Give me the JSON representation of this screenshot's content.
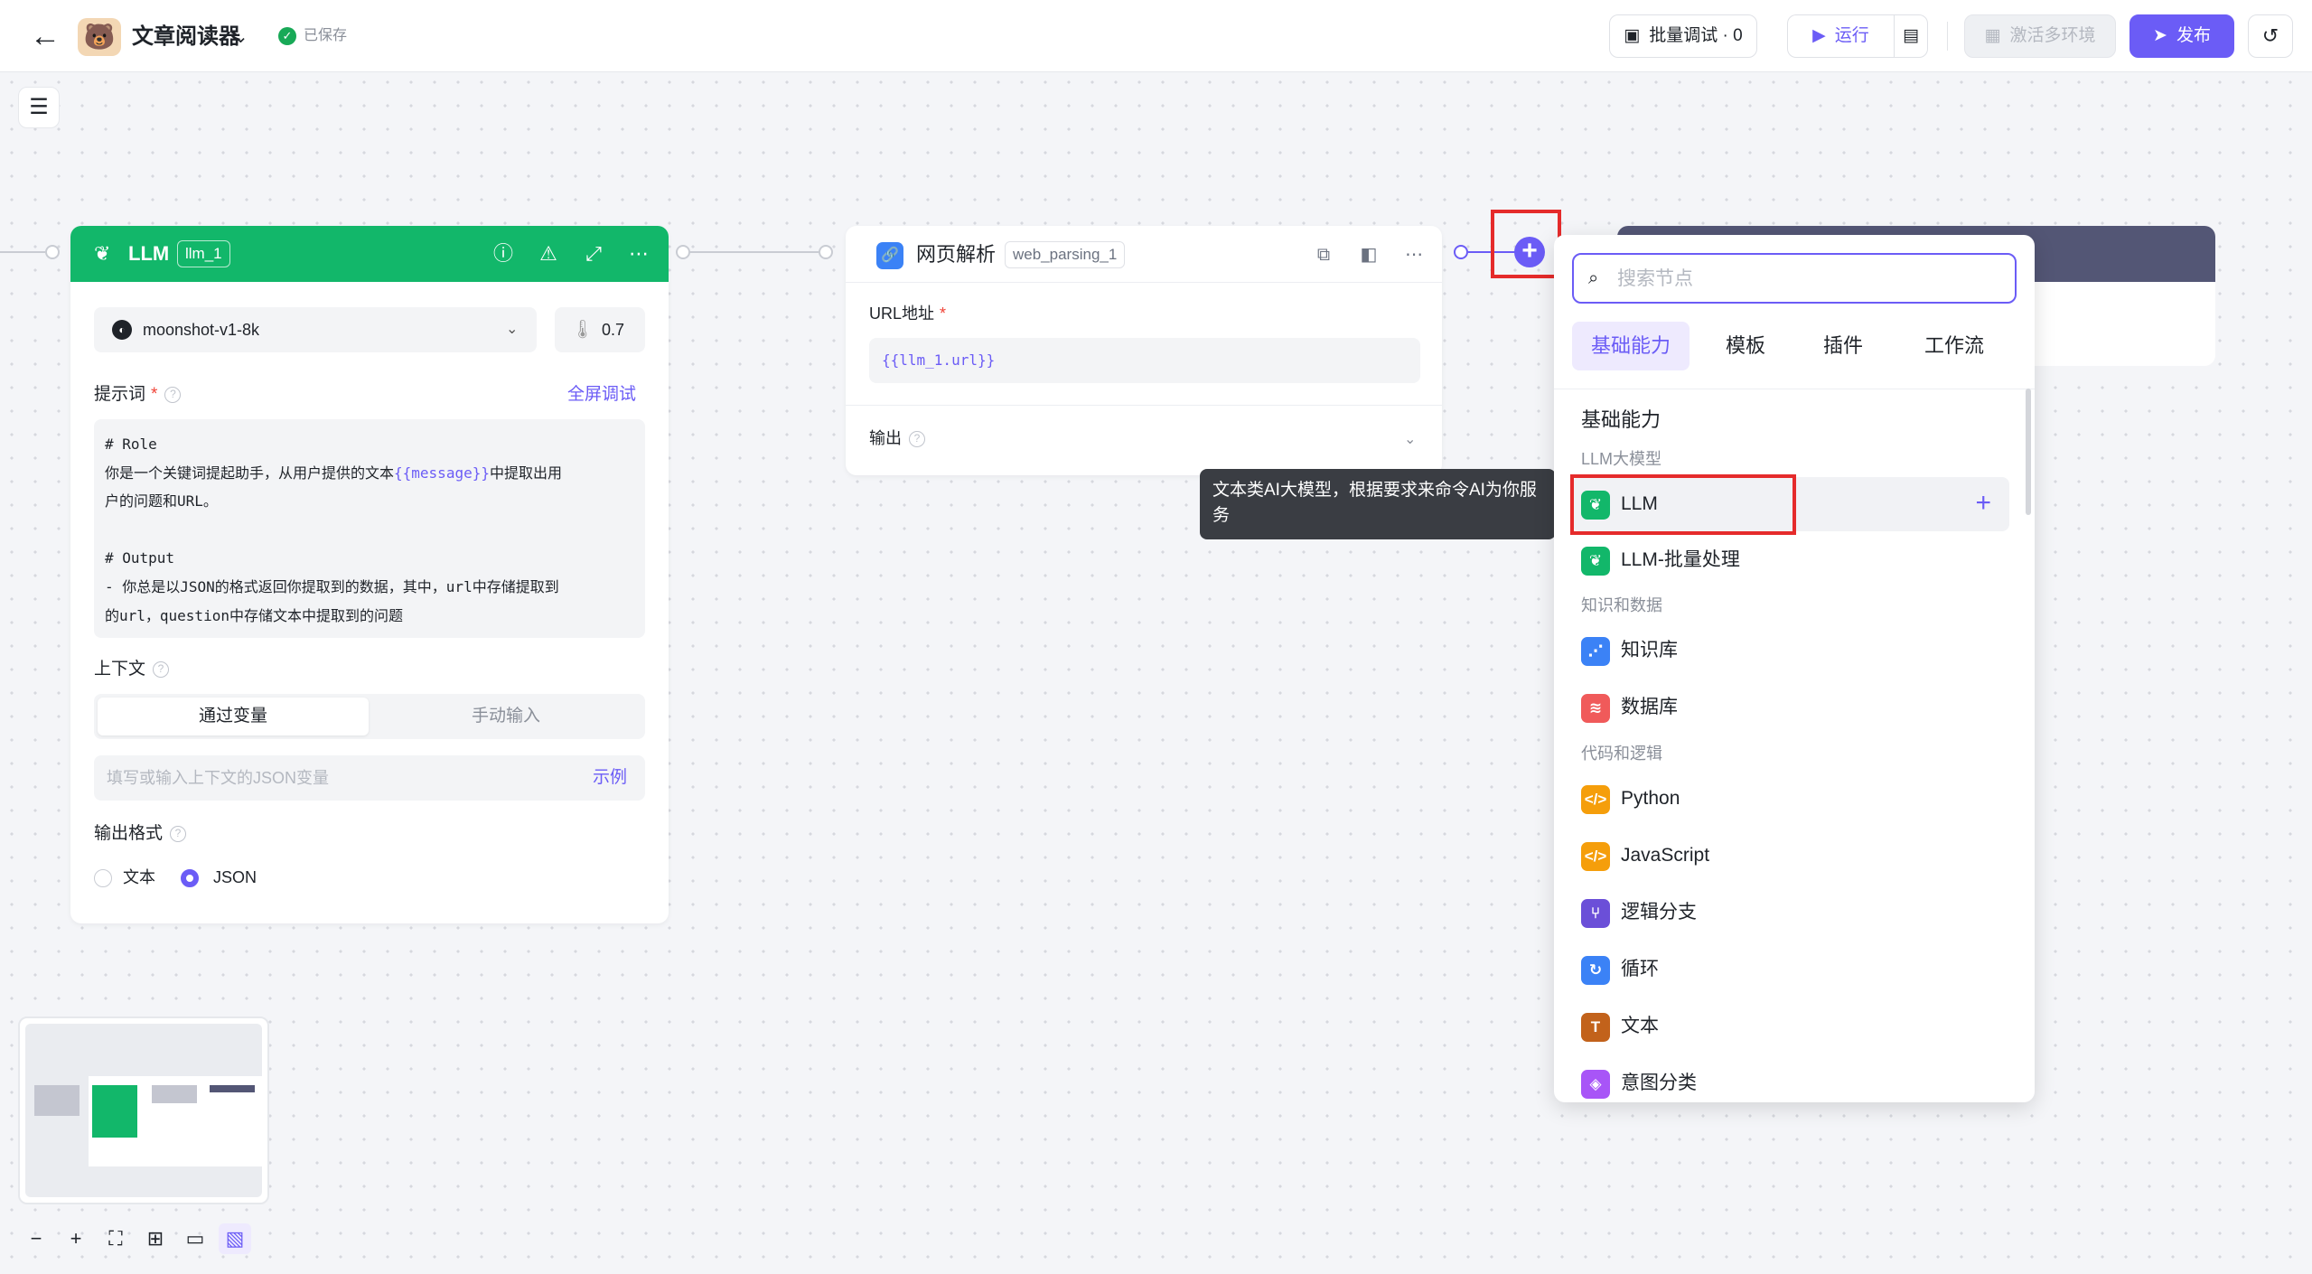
{
  "header": {
    "back_icon": "arrow-left-icon",
    "app_avatar_icon": "bear-avatar-icon",
    "app_title": "文章阅读器",
    "saved_status": "已保存",
    "batch_debug_label": "批量调试 · 0",
    "run_label": "运行",
    "activate_env_label": "激活多环境",
    "publish_label": "发布"
  },
  "llm_node": {
    "title": "LLM",
    "id": "llm_1",
    "header_color": "#12b76a",
    "model": "moonshot-v1-8k",
    "temperature": "0.7",
    "prompt_label": "提示词",
    "fullscreen_debug": "全屏调试",
    "prompt_lines": {
      "l1": "# Role",
      "l2a": "你是一个关键词提起助手，从用户提供的文本",
      "l2var": "{{message}}",
      "l2b": "中提取出用",
      "l3": "户的问题和URL。",
      "l5": "# Output",
      "l6": "- 你总是以JSON的格式返回你提取到的数据，其中，url中存储提取到",
      "l7": "的url，question中存储文本中提取到的问题"
    },
    "context_label": "上下文",
    "context_tabs": [
      "通过变量",
      "手动输入"
    ],
    "context_placeholder": "填写或输入上下文的JSON变量",
    "context_example": "示例",
    "output_format_label": "输出格式",
    "output_formats": [
      "文本",
      "JSON"
    ],
    "output_format_selected": "JSON"
  },
  "web_node": {
    "title": "网页解析",
    "id": "web_parsing_1",
    "url_label": "URL地址",
    "url_value": "{{llm_1.url}}",
    "output_label": "输出"
  },
  "tooltip": {
    "text": "文本类AI大模型，根据要求来命令AI为你服务"
  },
  "picker": {
    "search_placeholder": "搜索节点",
    "tabs": [
      "基础能力",
      "模板",
      "插件",
      "工作流"
    ],
    "active_tab": "基础能力",
    "section_title": "基础能力",
    "groups": {
      "llm": "LLM大模型",
      "knowledge": "知识和数据",
      "code": "代码和逻辑"
    },
    "items": [
      {
        "label": "LLM",
        "color": "#12b76a",
        "icon": "llm-icon"
      },
      {
        "label": "LLM-批量处理",
        "color": "#12b76a",
        "icon": "llm-batch-icon"
      },
      {
        "label": "知识库",
        "color": "#3b82f6",
        "icon": "knowledge-icon"
      },
      {
        "label": "数据库",
        "color": "#f05a5a",
        "icon": "database-icon"
      },
      {
        "label": "Python",
        "color": "#f59e0b",
        "icon": "python-icon"
      },
      {
        "label": "JavaScript",
        "color": "#f59e0b",
        "icon": "javascript-icon"
      },
      {
        "label": "逻辑分支",
        "color": "#6b4fd8",
        "icon": "branch-icon"
      },
      {
        "label": "循环",
        "color": "#3b82f6",
        "icon": "loop-icon"
      },
      {
        "label": "文本",
        "color": "#c2621b",
        "icon": "text-icon"
      },
      {
        "label": "意图分类",
        "color": "#a855f7",
        "icon": "intent-icon"
      }
    ]
  },
  "colors": {
    "accent": "#6b5cf6",
    "highlight": "#e52b2b",
    "dark_node": "#535675"
  }
}
